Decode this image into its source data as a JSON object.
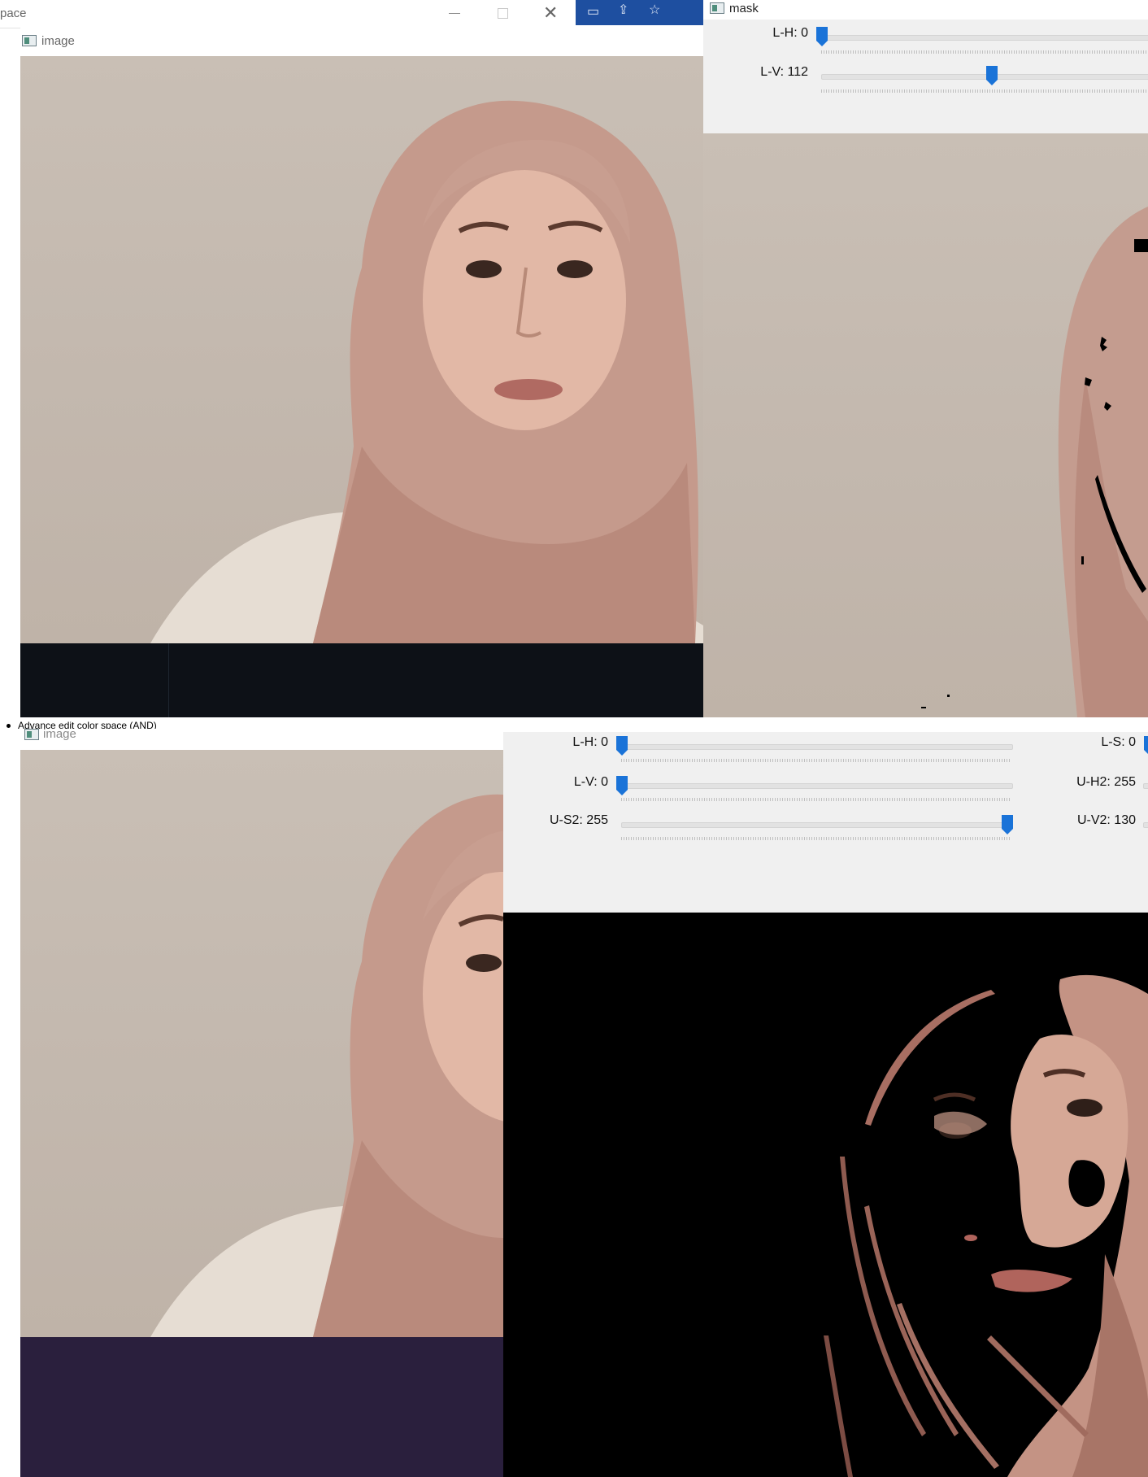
{
  "top_left_window": {
    "title_partial": "pace",
    "controls": [
      "minimize",
      "maximize",
      "close"
    ],
    "inner_title": "image"
  },
  "mask_window": {
    "title": "mask",
    "trackbars": [
      {
        "label": "L-H: 0",
        "value": 0,
        "max": 255
      },
      {
        "label": "L-V: 112",
        "value": 112,
        "max": 255
      }
    ]
  },
  "caption": "Advance edit color space (AND)",
  "bottom_left_window": {
    "title": "image"
  },
  "bottom_right_window": {
    "trackbars_left": [
      {
        "label": "L-H: 0",
        "value": 0,
        "max": 255
      },
      {
        "label": "L-V: 0",
        "value": 0,
        "max": 255
      },
      {
        "label": "U-S2: 255",
        "value": 255,
        "max": 255
      }
    ],
    "trackbars_right": [
      {
        "label": "L-S: 0"
      },
      {
        "label": "U-H2: 255"
      },
      {
        "label": "U-V2: 130"
      }
    ]
  },
  "colors": {
    "trackbar_thumb": "#1a73d8",
    "taskbar_blue": "#1e4fa0",
    "dark_strip": "#0d1117",
    "purple_strip": "#2a1f3d"
  }
}
